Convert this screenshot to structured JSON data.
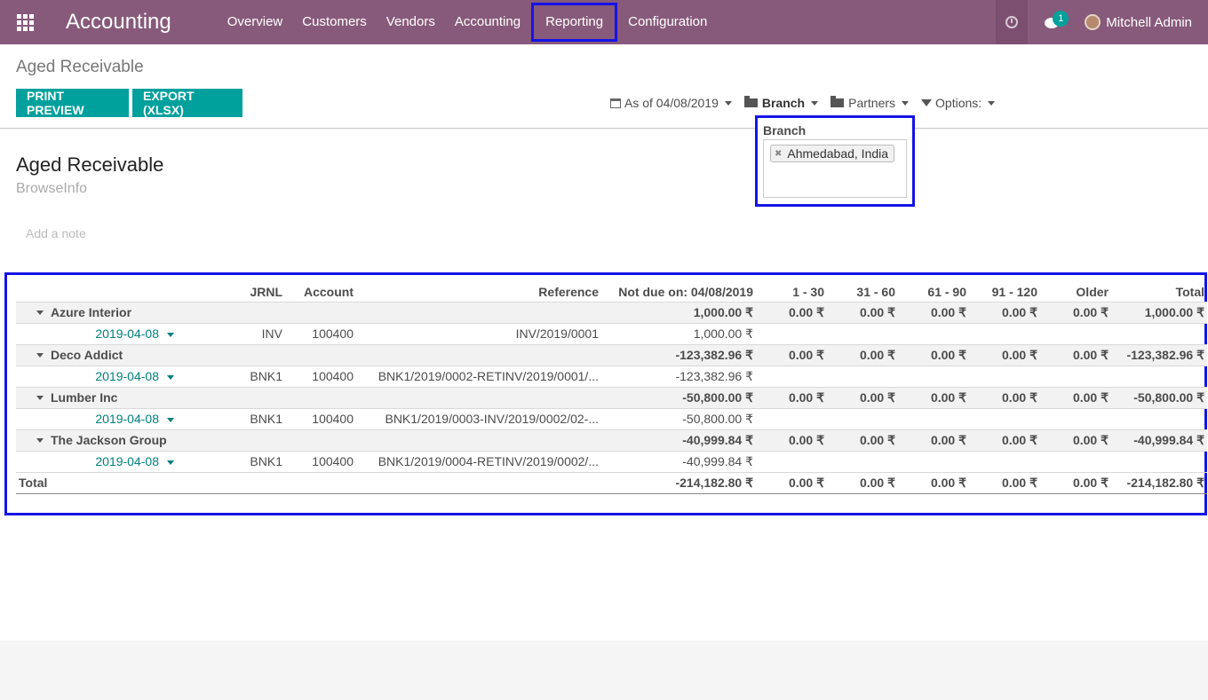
{
  "navbar": {
    "app_name": "Accounting",
    "menu": [
      "Overview",
      "Customers",
      "Vendors",
      "Accounting",
      "Reporting",
      "Configuration"
    ],
    "active_menu": "Reporting",
    "chat_badge": "1",
    "user_name": "Mitchell Admin"
  },
  "control_panel": {
    "breadcrumb": "Aged Receivable",
    "print_label": "PRINT PREVIEW",
    "export_label": "EXPORT (XLSX)",
    "date_filter": "As of 04/08/2019",
    "branch_filter": "Branch",
    "partners_filter": "Partners",
    "options_filter": "Options:"
  },
  "branch_dropdown": {
    "label": "Branch",
    "tags": [
      "Ahmedabad, India"
    ]
  },
  "report": {
    "title": "Aged Receivable",
    "company": "BrowseInfo",
    "note_placeholder": "Add a note",
    "columns": [
      "",
      "JRNL",
      "Account",
      "Reference",
      "Not due on: 04/08/2019",
      "1 - 30",
      "31 - 60",
      "61 - 90",
      "91 - 120",
      "Older",
      "Total"
    ],
    "partners": [
      {
        "name": "Azure Interior",
        "values": [
          "1,000.00 ₹",
          "0.00 ₹",
          "0.00 ₹",
          "0.00 ₹",
          "0.00 ₹",
          "0.00 ₹",
          "1,000.00 ₹"
        ],
        "line": {
          "date": "2019-04-08",
          "jrnl": "INV",
          "account": "100400",
          "reference": "INV/2019/0001",
          "not_due": "1,000.00 ₹"
        }
      },
      {
        "name": "Deco Addict",
        "values": [
          "-123,382.96 ₹",
          "0.00 ₹",
          "0.00 ₹",
          "0.00 ₹",
          "0.00 ₹",
          "0.00 ₹",
          "-123,382.96 ₹"
        ],
        "line": {
          "date": "2019-04-08",
          "jrnl": "BNK1",
          "account": "100400",
          "reference": "BNK1/2019/0002-RETINV/2019/0001/...",
          "not_due": "-123,382.96 ₹"
        }
      },
      {
        "name": "Lumber Inc",
        "values": [
          "-50,800.00 ₹",
          "0.00 ₹",
          "0.00 ₹",
          "0.00 ₹",
          "0.00 ₹",
          "0.00 ₹",
          "-50,800.00 ₹"
        ],
        "line": {
          "date": "2019-04-08",
          "jrnl": "BNK1",
          "account": "100400",
          "reference": "BNK1/2019/0003-INV/2019/0002/02-...",
          "not_due": "-50,800.00 ₹"
        }
      },
      {
        "name": "The Jackson Group",
        "values": [
          "-40,999.84 ₹",
          "0.00 ₹",
          "0.00 ₹",
          "0.00 ₹",
          "0.00 ₹",
          "0.00 ₹",
          "-40,999.84 ₹"
        ],
        "line": {
          "date": "2019-04-08",
          "jrnl": "BNK1",
          "account": "100400",
          "reference": "BNK1/2019/0004-RETINV/2019/0002/...",
          "not_due": "-40,999.84 ₹"
        }
      }
    ],
    "total": {
      "label": "Total",
      "values": [
        "-214,182.80 ₹",
        "0.00 ₹",
        "0.00 ₹",
        "0.00 ₹",
        "0.00 ₹",
        "0.00 ₹",
        "-214,182.80 ₹"
      ]
    }
  }
}
